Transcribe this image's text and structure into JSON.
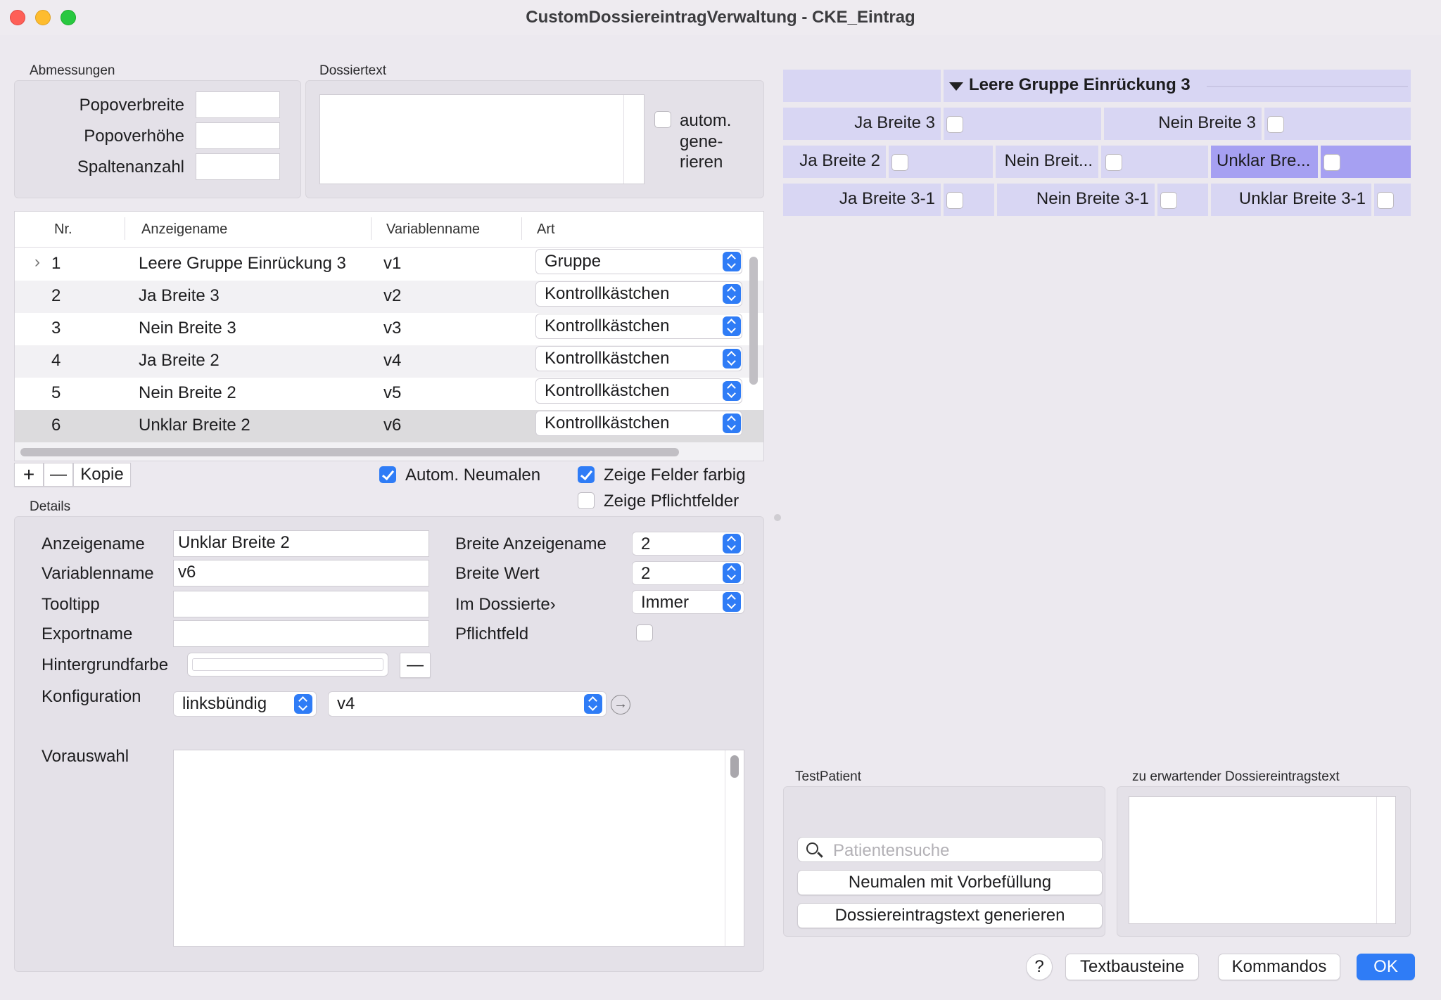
{
  "window": {
    "title": "CustomDossiereintragVerwaltung - CKE_Eintrag"
  },
  "abmessungen": {
    "label": "Abmessungen",
    "popoverbreite": "Popoverbreite",
    "popoverhoehe": "Popoverhöhe",
    "spaltenanzahl": "Spaltenanzahl"
  },
  "dossiertext": {
    "label": "Dossiertext",
    "auto_line1": "autom.",
    "auto_line2": "gene-",
    "auto_line3": "rieren"
  },
  "table": {
    "headers": {
      "nr": "Nr.",
      "anzeigename": "Anzeigename",
      "variablenname": "Variablenname",
      "art": "Art"
    },
    "rows": [
      {
        "nr": "1",
        "name": "Leere Gruppe Einrückung 3",
        "var": "v1",
        "art": "Gruppe"
      },
      {
        "nr": "2",
        "name": "Ja Breite 3",
        "var": "v2",
        "art": "Kontrollkästchen"
      },
      {
        "nr": "3",
        "name": "Nein Breite 3",
        "var": "v3",
        "art": "Kontrollkästchen"
      },
      {
        "nr": "4",
        "name": "Ja Breite 2",
        "var": "v4",
        "art": "Kontrollkästchen"
      },
      {
        "nr": "5",
        "name": "Nein Breite 2",
        "var": "v5",
        "art": "Kontrollkästchen"
      },
      {
        "nr": "6",
        "name": "Unklar Breite 2",
        "var": "v6",
        "art": "Kontrollkästchen"
      }
    ]
  },
  "toolbar": {
    "add": "+",
    "remove": "—",
    "copy": "Kopie",
    "auto_neumalen": "Autom. Neumalen",
    "zeige_farbig": "Zeige Felder farbig",
    "zeige_pflicht": "Zeige Pflichtfelder"
  },
  "details": {
    "label": "Details",
    "anzeigename_label": "Anzeigename",
    "anzeigename_value": "Unklar Breite 2",
    "variablenname_label": "Variablenname",
    "variablenname_value": "v6",
    "tooltipp_label": "Tooltipp",
    "exportname_label": "Exportname",
    "hintergrund_label": "Hintergrundfarbe",
    "hintergrund_clear": "—",
    "konfig_label": "Konfiguration",
    "konfig_align": "linksbündig",
    "konfig_var": "v4",
    "breite_anzeige_label": "Breite Anzeigename",
    "breite_anzeige_value": "2",
    "breite_wert_label": "Breite Wert",
    "breite_wert_value": "2",
    "im_dossier_label": "Im Dossierte›",
    "im_dossier_value": "Immer",
    "pflicht_label": "Pflichtfeld",
    "vorauswahl_label": "Vorauswahl"
  },
  "preview": {
    "group_title": "Leere Gruppe Einrückung 3",
    "r1c1": "Ja Breite 3",
    "r1c2": "Nein Breite 3",
    "r2c1": "Ja Breite 2",
    "r2c2": "Nein Breit...",
    "r2c3": "Unklar Bre...",
    "r3c1": "Ja Breite 3-1",
    "r3c2": "Nein Breite 3-1",
    "r3c3": "Unklar Breite 3-1"
  },
  "testpatient": {
    "label": "TestPatient",
    "search_placeholder": "Patientensuche",
    "neumalen": "Neumalen mit Vorbefüllung",
    "generieren": "Dossiereintragstext generieren"
  },
  "erwartet": {
    "label": "zu erwartender Dossiereintragstext"
  },
  "footer": {
    "help": "?",
    "textbausteine": "Textbausteine",
    "kommandos": "Kommandos",
    "ok": "OK"
  }
}
